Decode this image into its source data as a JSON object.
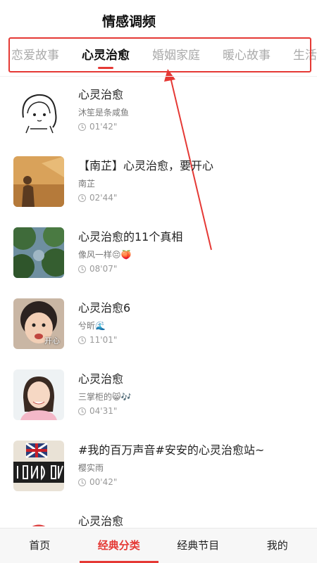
{
  "header": {
    "title": "情感调频"
  },
  "tabs": [
    {
      "label": "恋爱故事",
      "active": false
    },
    {
      "label": "心灵治愈",
      "active": true
    },
    {
      "label": "婚姻家庭",
      "active": false
    },
    {
      "label": "暖心故事",
      "active": false
    },
    {
      "label": "生活",
      "active": false
    }
  ],
  "items": [
    {
      "title": "心灵治愈",
      "author": "沐笙是条咸鱼",
      "duration": "01'42\""
    },
    {
      "title": "【南芷】心灵治愈，要开心",
      "author": "南芷",
      "duration": "02'44\""
    },
    {
      "title": "心灵治愈的11个真相",
      "author": "像风一样😔🍑",
      "duration": "08'07\""
    },
    {
      "title": "心灵治愈6",
      "author": "兮昕🌊",
      "duration": "11'01\"",
      "thumb_caption": "开心"
    },
    {
      "title": "心灵治愈",
      "author": "三掌柜的😸🎶",
      "duration": "04'31\""
    },
    {
      "title": "#我的百万声音#安安的心灵治愈站~",
      "author": "樱实雨",
      "duration": "00'42\""
    },
    {
      "title": "心灵治愈",
      "author": "",
      "duration": ""
    }
  ],
  "bottom_nav": [
    {
      "label": "首页",
      "active": false
    },
    {
      "label": "经典分类",
      "active": true
    },
    {
      "label": "经典节目",
      "active": false
    },
    {
      "label": "我的",
      "active": false
    }
  ],
  "colors": {
    "accent": "#e53935",
    "inactive_tab": "#aaaaaa"
  }
}
